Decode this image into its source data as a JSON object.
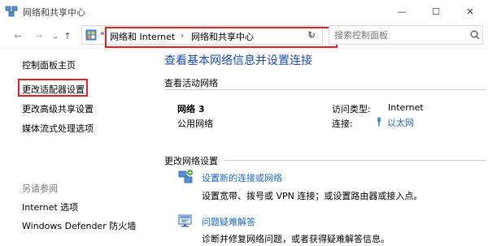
{
  "window": {
    "title": "网络和共享中心",
    "min_glyph": "—",
    "max_glyph": "☐",
    "close_glyph": "✕"
  },
  "nav": {
    "back_glyph": "←",
    "forward_glyph": "→",
    "recent_glyph": "⌄",
    "up_glyph": "↑",
    "address_lead": "«",
    "breadcrumbs": [
      "网络和 Internet",
      "网络和共享中心"
    ],
    "separator": "›",
    "dropdown_glyph": "⌄",
    "refresh_glyph": "↻",
    "search_placeholder": "搜索控制面板"
  },
  "sidebar": {
    "home": "控制面板主页",
    "items": [
      "更改适配器设置",
      "更改高级共享设置",
      "媒体流式处理选项"
    ],
    "see_also_title": "另请参阅",
    "see_also": [
      "Internet 选项",
      "Windows Defender 防火墙"
    ]
  },
  "main": {
    "heading": "查看基本网络信息并设置连接",
    "active_title": "查看活动网络",
    "network_name": "网络 3",
    "network_type": "公用网络",
    "access_type_label": "访问类型:",
    "access_type_value": "Internet",
    "connection_label": "连接:",
    "connection_value": "以太网",
    "change_title": "更改网络设置",
    "tasks": [
      {
        "link": "设置新的连接或网络",
        "desc": "设置宽带、拨号或 VPN 连接；或设置路由器或接入点。"
      },
      {
        "link": "问题疑难解答",
        "desc": "诊断并修复网络问题，或者获得疑难解答信息。"
      }
    ]
  },
  "colors": {
    "link": "#1e66c9",
    "heading": "#1e4ea8",
    "highlight": "#e31e24"
  }
}
